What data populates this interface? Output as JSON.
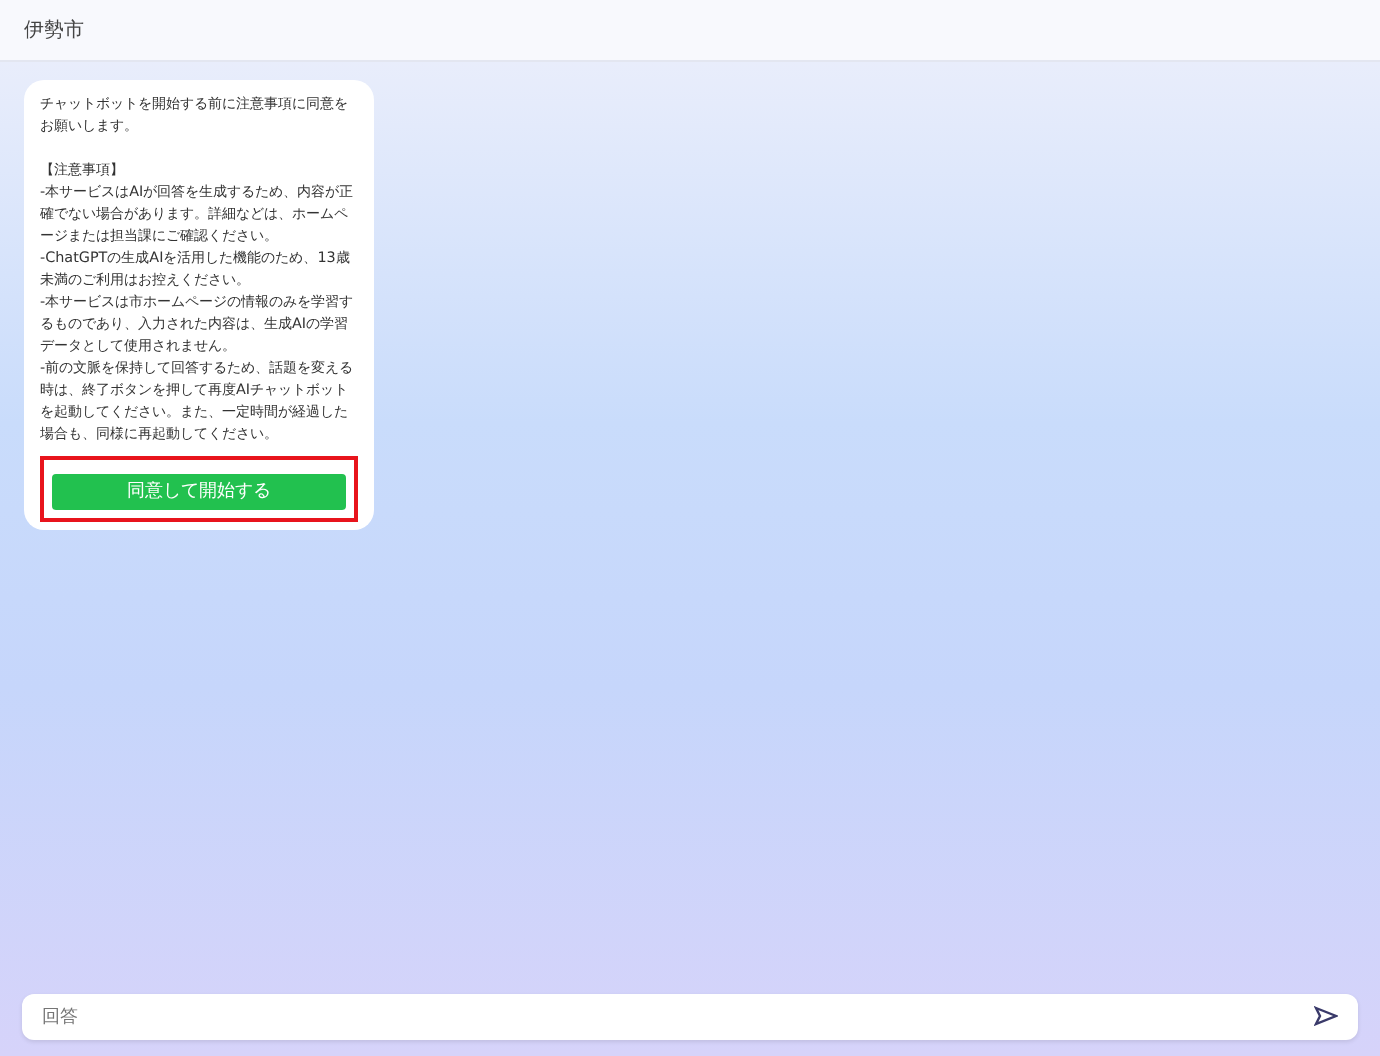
{
  "header": {
    "title": "伊勢市"
  },
  "message": {
    "intro": "チャットボットを開始する前に注意事項に同意をお願いします。",
    "notice_title": "【注意事項】",
    "notices": [
      "-本サービスはAIが回答を生成するため、内容が正確でない場合があります。詳細などは、ホームページまたは担当課にご確認ください。",
      "-ChatGPTの生成AIを活用した機能のため、13歳未満のご利用はお控えください。",
      "-本サービスは市ホームページの情報のみを学習するものであり、入力された内容は、生成AIの学習データとして使用されません。",
      "-前の文脈を保持して回答するため、話題を変える時は、終了ボタンを押して再度AIチャットボットを起動してください。また、一定時間が経過した場合も、同様に再起動してください。"
    ],
    "button": {
      "label": "同意して開始する",
      "highlighted": true
    }
  },
  "input": {
    "placeholder": "回答"
  }
}
